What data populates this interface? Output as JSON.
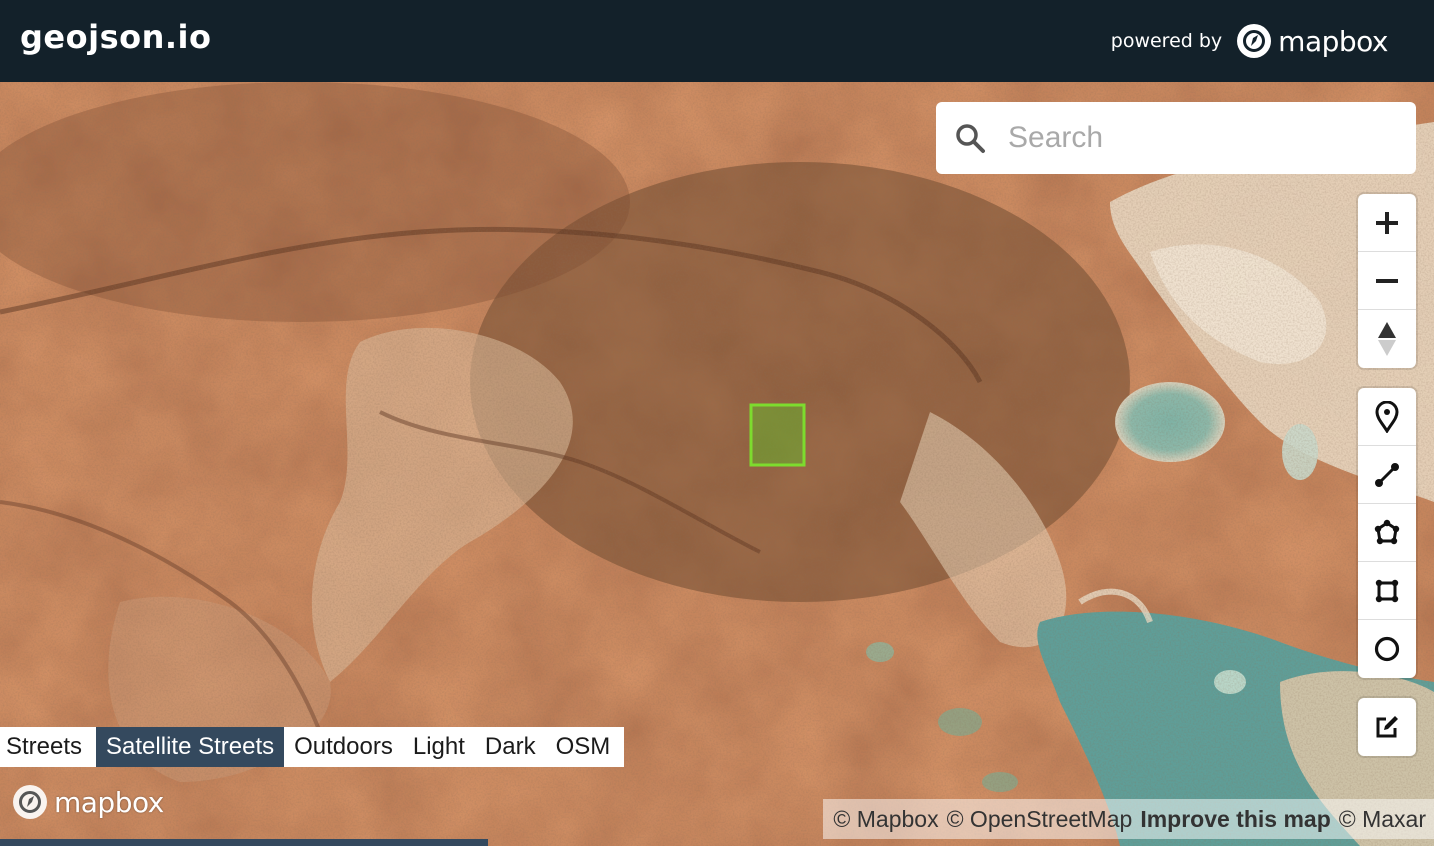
{
  "app": {
    "title": "geojson.io",
    "powered_by": "powered by",
    "mapbox_word": "mapbox"
  },
  "search": {
    "placeholder": "Search",
    "icon": "search-icon"
  },
  "zoom_controls": [
    {
      "name": "zoom-in-button",
      "icon": "plus-icon"
    },
    {
      "name": "zoom-out-button",
      "icon": "minus-icon"
    },
    {
      "name": "compass-button",
      "icon": "compass-icon"
    }
  ],
  "draw_controls": [
    {
      "name": "draw-point-button",
      "icon": "marker-icon"
    },
    {
      "name": "draw-line-button",
      "icon": "line-icon"
    },
    {
      "name": "draw-polygon-button",
      "icon": "polygon-icon"
    },
    {
      "name": "draw-rectangle-button",
      "icon": "rectangle-icon"
    },
    {
      "name": "draw-circle-button",
      "icon": "circle-icon"
    }
  ],
  "edit_control": {
    "name": "edit-button",
    "icon": "edit-icon"
  },
  "map_styles": {
    "options": [
      "Streets",
      "Satellite Streets",
      "Outdoors",
      "Light",
      "Dark",
      "OSM"
    ],
    "active": "Satellite Streets"
  },
  "attribution": {
    "mapbox": "© Mapbox",
    "osm": "© OpenStreetMap",
    "improve": "Improve this map",
    "maxar": "© Maxar"
  },
  "colors": {
    "topbar": "#13212a",
    "active_style": "#34495e",
    "feature_stroke": "#7ddc2e",
    "feature_fill": "#5fbf2a"
  },
  "loading_progress": 0.34
}
